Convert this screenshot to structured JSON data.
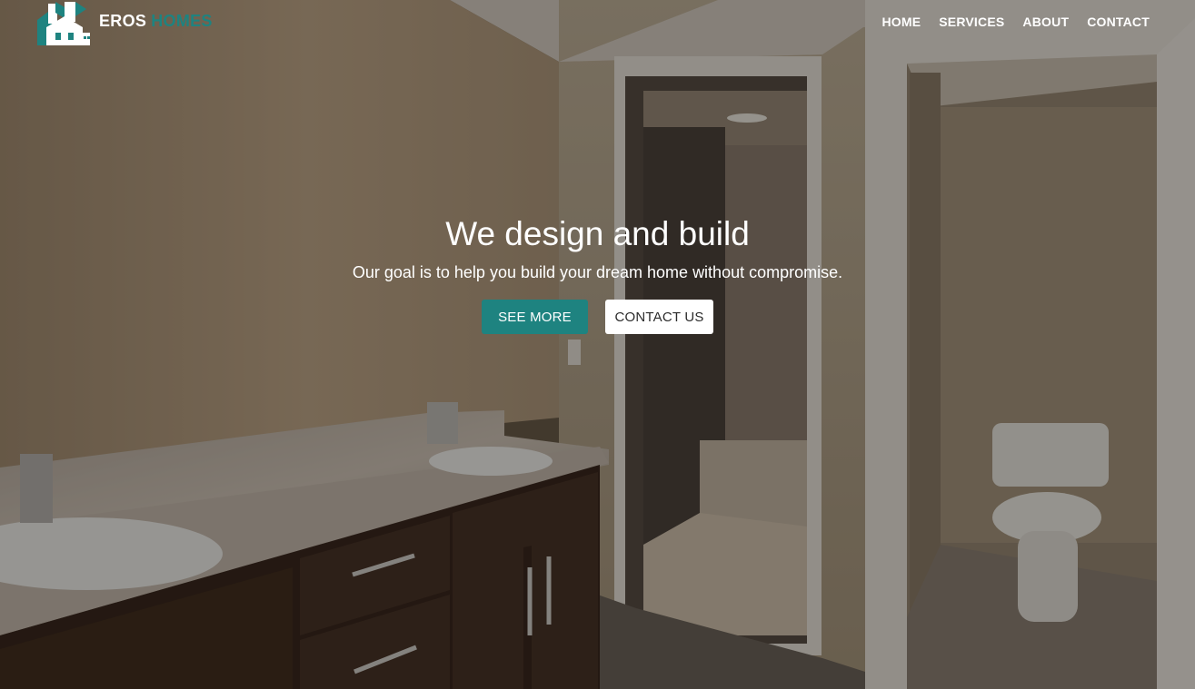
{
  "colors": {
    "accent": "#1e8380",
    "nav_text": "#ffffff",
    "overlay": "rgba(0,0,0,0.38)"
  },
  "brand": {
    "word1": "EROS",
    "word2": "HOMES",
    "icon": "house-buildings-logo"
  },
  "nav": {
    "items": [
      "HOME",
      "SERVICES",
      "ABOUT",
      "CONTACT"
    ]
  },
  "hero": {
    "title": "We design and build",
    "subtitle": "Our goal is to help you build your dream home without compromise.",
    "primary_button": "SEE MORE",
    "secondary_button": "CONTACT US",
    "background": "bathroom-interior-photo"
  }
}
